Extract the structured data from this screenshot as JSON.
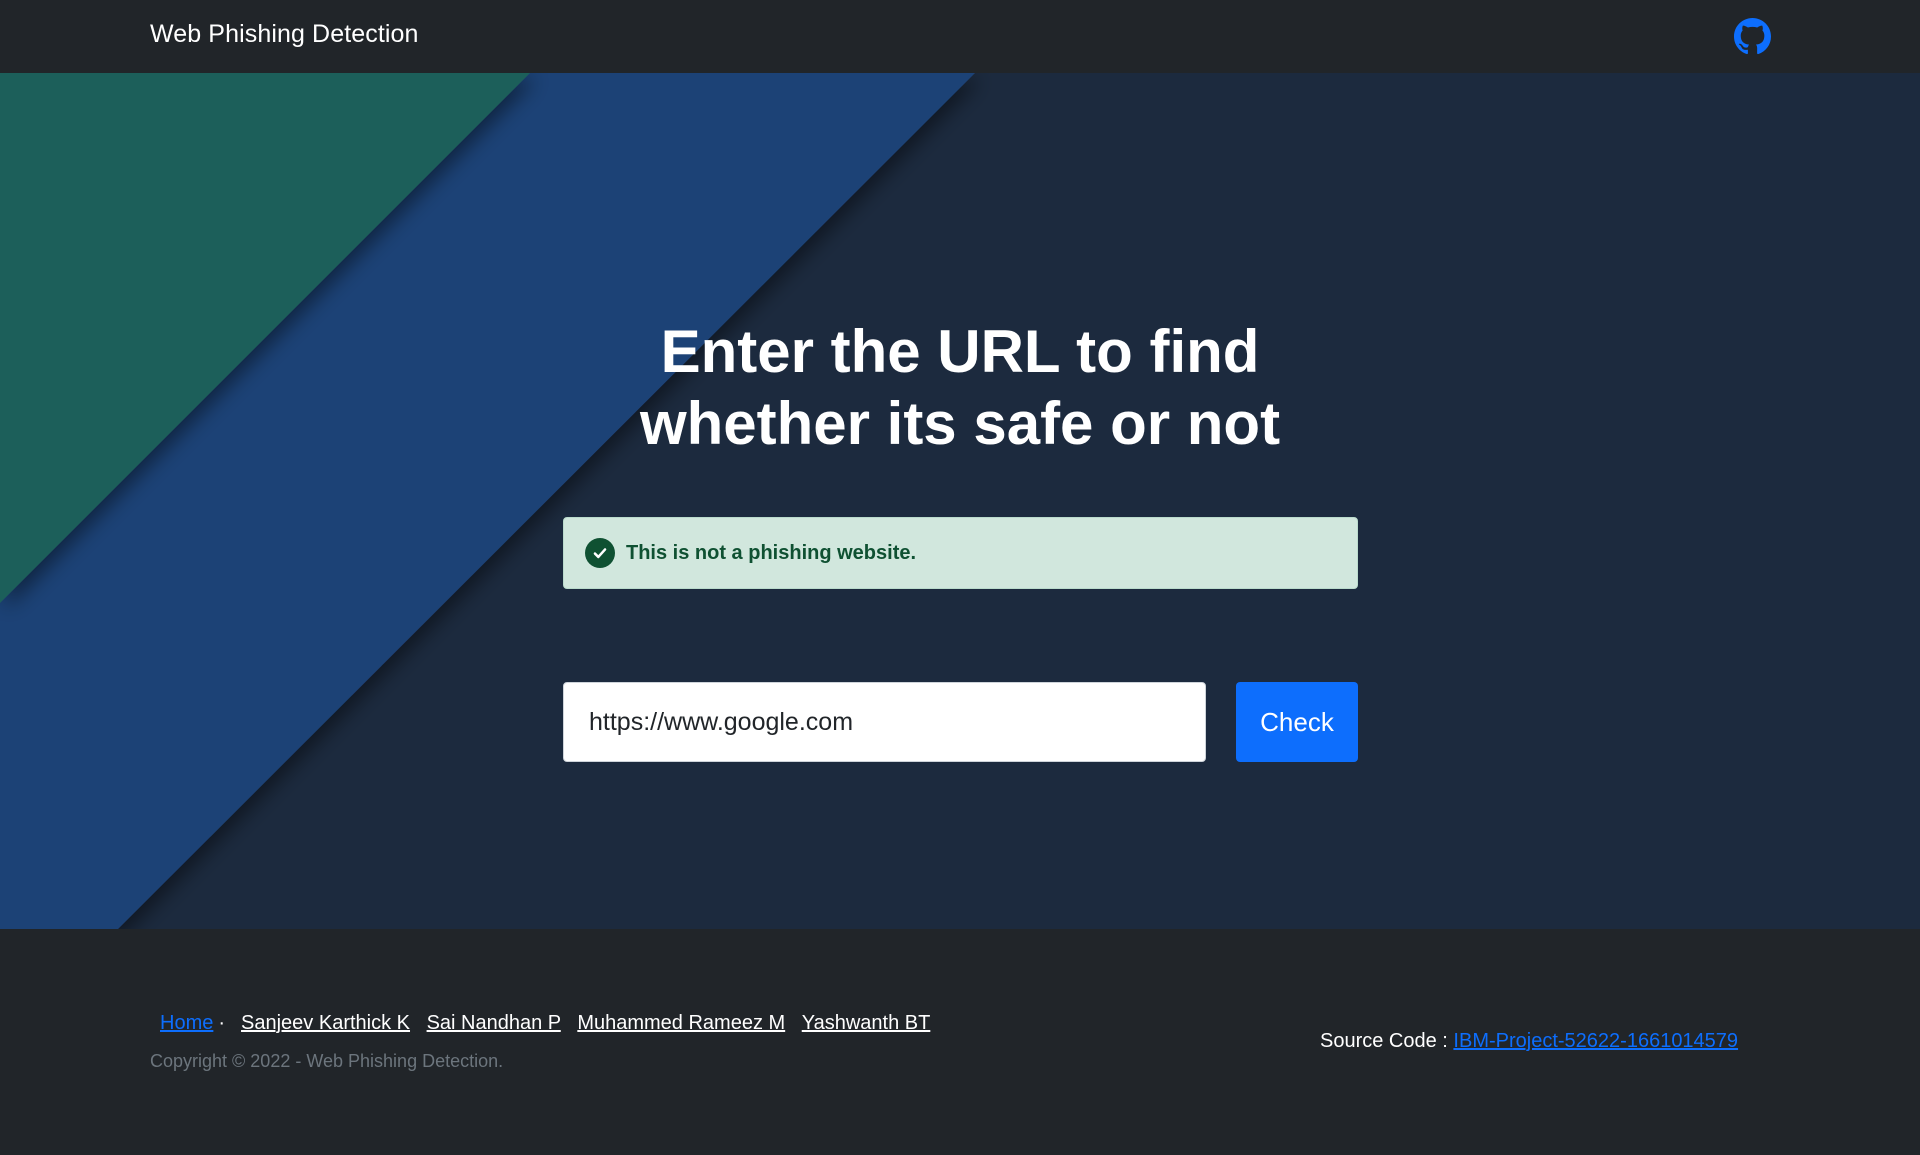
{
  "navbar": {
    "brand": "Web Phishing Detection",
    "github_icon": "github-icon"
  },
  "hero": {
    "title": "Enter the URL to find whether its safe or not",
    "alert": {
      "icon": "check-circle-icon",
      "text": "This is not a phishing website."
    },
    "url_input": {
      "value": "https://www.google.com"
    },
    "check_button": "Check"
  },
  "footer": {
    "home_link": "Home",
    "separator": "·",
    "people": [
      "Sanjeev Karthick K",
      "Sai Nandhan P",
      "Muhammed Rameez M",
      "Yashwanth BT"
    ],
    "copyright": "Copyright © 2022 - Web Phishing Detection.",
    "source_label": "Source Code :",
    "source_link": "IBM-Project-52622-1661014579"
  },
  "colors": {
    "background": "#212529",
    "hero_background": "#1c2a3e",
    "hero_green": "#1f5e5a",
    "hero_blue": "#1e4276",
    "accent": "#0d6efd",
    "alert_bg": "#d1e7dd",
    "alert_text": "#0f5132",
    "muted": "#6c757d"
  }
}
